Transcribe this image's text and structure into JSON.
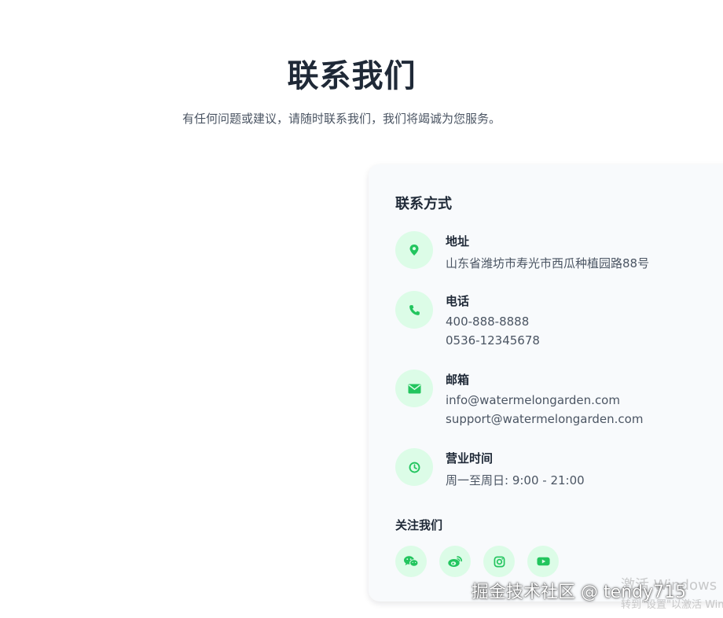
{
  "header": {
    "title": "联系我们",
    "subtitle": "有任何问题或建议，请随时联系我们，我们将竭诚为您服务。"
  },
  "contact": {
    "title": "联系方式",
    "address": {
      "label": "地址",
      "icon": "map-pin-icon",
      "lines": [
        "山东省潍坊市寿光市西瓜种植园路88号"
      ]
    },
    "phone": {
      "label": "电话",
      "icon": "phone-icon",
      "lines": [
        "400-888-8888",
        "0536-12345678"
      ]
    },
    "email": {
      "label": "邮箱",
      "icon": "envelope-icon",
      "lines": [
        "info@watermelongarden.com",
        "support@watermelongarden.com"
      ]
    },
    "hours": {
      "label": "营业时间",
      "icon": "clock-icon",
      "lines": [
        "周一至周日: 9:00 - 21:00"
      ]
    }
  },
  "follow": {
    "title": "关注我们",
    "icons": [
      "wechat-icon",
      "weibo-icon",
      "instagram-icon",
      "youtube-icon"
    ]
  },
  "colors": {
    "accent": "#22c55e",
    "icon_bg": "#dcfce7",
    "card_bg": "#f8fafc",
    "text_dark": "#1f2937",
    "text_muted": "#4b5563"
  },
  "watermark": {
    "text": "掘金技术社区 @ tendy715",
    "windows_line1": "激活 Windows",
    "windows_line2": "转到\"设置\"以激活 Windows"
  }
}
